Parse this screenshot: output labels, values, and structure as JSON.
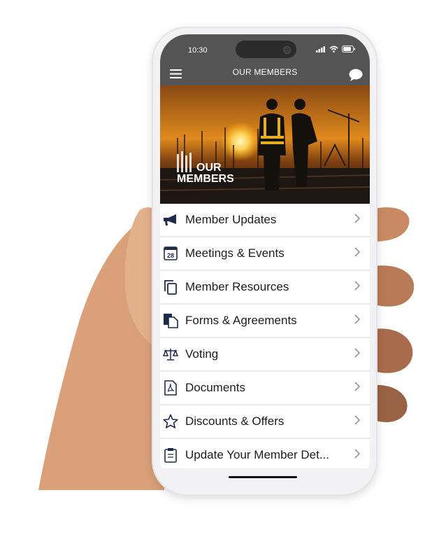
{
  "status_bar": {
    "time": "10:30"
  },
  "header": {
    "title": "OUR MEMBERS"
  },
  "hero": {
    "logo_text_line1": "OUR",
    "logo_text_line2": "MEMBERS"
  },
  "menu": [
    {
      "label": "Member Updates",
      "icon": "megaphone-icon"
    },
    {
      "label": "Meetings & Events",
      "icon": "calendar-icon",
      "icon_text": "28"
    },
    {
      "label": "Member Resources",
      "icon": "copy-icon"
    },
    {
      "label": "Forms & Agreements",
      "icon": "forms-icon"
    },
    {
      "label": "Voting",
      "icon": "scales-icon"
    },
    {
      "label": "Documents",
      "icon": "pdf-icon"
    },
    {
      "label": "Discounts & Offers",
      "icon": "star-icon"
    },
    {
      "label": "Update Your Member Det...",
      "icon": "clipboard-icon"
    }
  ],
  "colors": {
    "header": "#545454",
    "icon": "#1f2a4d",
    "sky": "#e08a1e"
  }
}
